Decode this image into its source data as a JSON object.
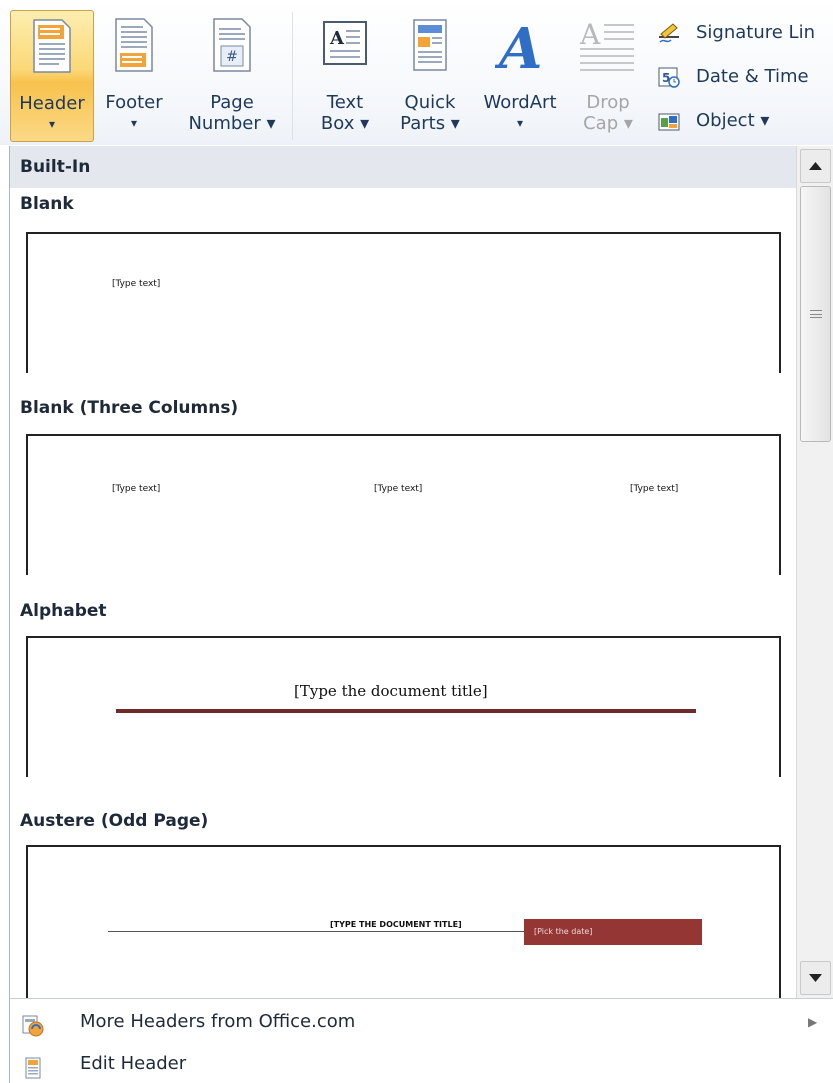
{
  "ribbon": {
    "header": {
      "line1": "Header",
      "line2": "▾"
    },
    "footer": {
      "line1": "Footer",
      "line2": "▾"
    },
    "page_number": {
      "line1": "Page",
      "line2": "Number ▾"
    },
    "text_box": {
      "line1": "Text",
      "line2": "Box ▾"
    },
    "quick_parts": {
      "line1": "Quick",
      "line2": "Parts ▾"
    },
    "wordart": {
      "line1": "WordArt",
      "line2": "▾"
    },
    "drop_cap": {
      "line1": "Drop",
      "line2": "Cap ▾"
    },
    "signature_line": "Signature Lin",
    "date_time": "Date & Time",
    "object": "Object ▾"
  },
  "gallery": {
    "category": "Built-In",
    "items": [
      {
        "title": "Blank",
        "placeholders": [
          "[Type text]"
        ]
      },
      {
        "title": "Blank (Three Columns)",
        "placeholders": [
          "[Type text]",
          "[Type text]",
          "[Type text]"
        ]
      },
      {
        "title": "Alphabet",
        "placeholders": [
          "[Type the document title]"
        ]
      },
      {
        "title": "Austere (Odd Page)",
        "placeholders": [
          "[TYPE THE DOCUMENT TITLE]",
          "[Pick the date]"
        ]
      }
    ]
  },
  "menu": {
    "more_headers": "More Headers from Office.com",
    "edit_header": "Edit Header"
  },
  "colors": {
    "active_button": "#f8c24d",
    "alphabet_rule": "#6e2b2b",
    "austere_date_bg": "#943634"
  }
}
